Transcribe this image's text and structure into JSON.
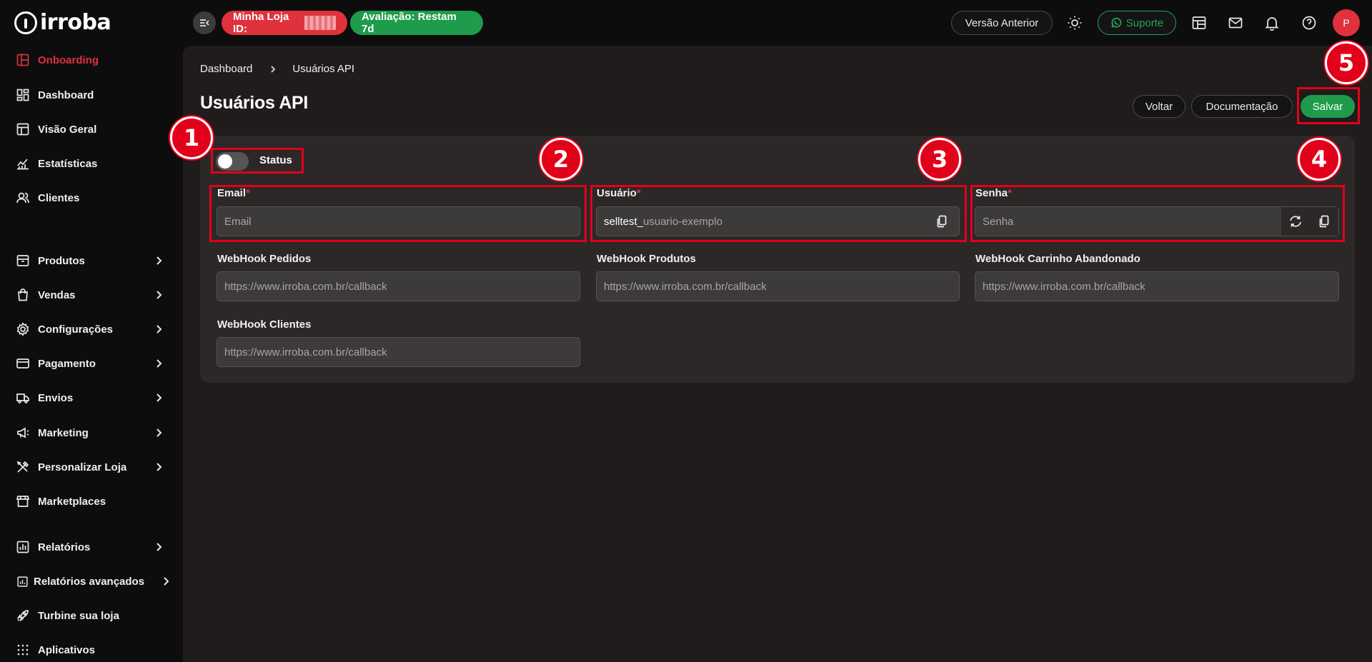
{
  "app": {
    "logo_text": "irroba"
  },
  "sidebar": {
    "items": [
      {
        "label": "Onboarding",
        "icon": "layout-icon",
        "active": true,
        "has_submenu": false
      },
      {
        "label": "Dashboard",
        "icon": "dashboard-icon",
        "has_submenu": false
      },
      {
        "label": "Visão Geral",
        "icon": "table-layout-icon",
        "has_submenu": false
      },
      {
        "label": "Estatísticas",
        "icon": "stats-icon",
        "has_submenu": false
      },
      {
        "label": "Clientes",
        "icon": "users-icon",
        "has_submenu": false
      },
      {
        "label": "Produtos",
        "icon": "box-icon",
        "has_submenu": true
      },
      {
        "label": "Vendas",
        "icon": "bag-icon",
        "has_submenu": true
      },
      {
        "label": "Configurações",
        "icon": "gear-icon",
        "has_submenu": true
      },
      {
        "label": "Pagamento",
        "icon": "card-icon",
        "has_submenu": true
      },
      {
        "label": "Envios",
        "icon": "truck-icon",
        "has_submenu": true
      },
      {
        "label": "Marketing",
        "icon": "megaphone-icon",
        "has_submenu": true
      },
      {
        "label": "Personalizar Loja",
        "icon": "tools-icon",
        "has_submenu": true
      },
      {
        "label": "Marketplaces",
        "icon": "store-icon",
        "has_submenu": false
      },
      {
        "label": "Relatórios",
        "icon": "report-icon",
        "has_submenu": true
      },
      {
        "label": "Relatórios avançados",
        "icon": "report-advanced-icon",
        "has_submenu": true
      },
      {
        "label": "Turbine sua loja",
        "icon": "rocket-icon",
        "has_submenu": false
      },
      {
        "label": "Aplicativos",
        "icon": "apps-icon",
        "has_submenu": false
      }
    ]
  },
  "topbar": {
    "store_id_label": "Minha Loja ID:",
    "trial_label": "Avaliação: Restam 7d",
    "previous_version_label": "Versão Anterior",
    "support_label": "Suporte",
    "avatar_initial": "P"
  },
  "page": {
    "breadcrumb": [
      "Dashboard",
      "Usuários API"
    ],
    "title": "Usuários API",
    "buttons": {
      "back": "Voltar",
      "docs": "Documentação",
      "save": "Salvar"
    }
  },
  "form": {
    "status_label": "Status",
    "status_on": false,
    "email": {
      "label": "Email",
      "required_mark": "*",
      "placeholder": "Email",
      "value": ""
    },
    "usuario": {
      "label": "Usuário",
      "required_mark": "*",
      "prefix": "selltest_",
      "placeholder": "usuario-exemplo"
    },
    "senha": {
      "label": "Senha",
      "required_mark": "*",
      "placeholder": "Senha",
      "value": ""
    },
    "webhooks": [
      {
        "label": "WebHook Pedidos",
        "placeholder": "https://www.irroba.com.br/callback"
      },
      {
        "label": "WebHook Produtos",
        "placeholder": "https://www.irroba.com.br/callback"
      },
      {
        "label": "WebHook Carrinho Abandonado",
        "placeholder": "https://www.irroba.com.br/callback"
      },
      {
        "label": "WebHook Clientes",
        "placeholder": "https://www.irroba.com.br/callback"
      }
    ]
  },
  "annotations": [
    "1",
    "2",
    "3",
    "4",
    "5"
  ],
  "colors": {
    "brand_red": "#e0323c",
    "success_green": "#1e9c4b",
    "annotation_red": "#e3001b",
    "background": "#0d0d0d",
    "panel": "#1f1c1b"
  }
}
